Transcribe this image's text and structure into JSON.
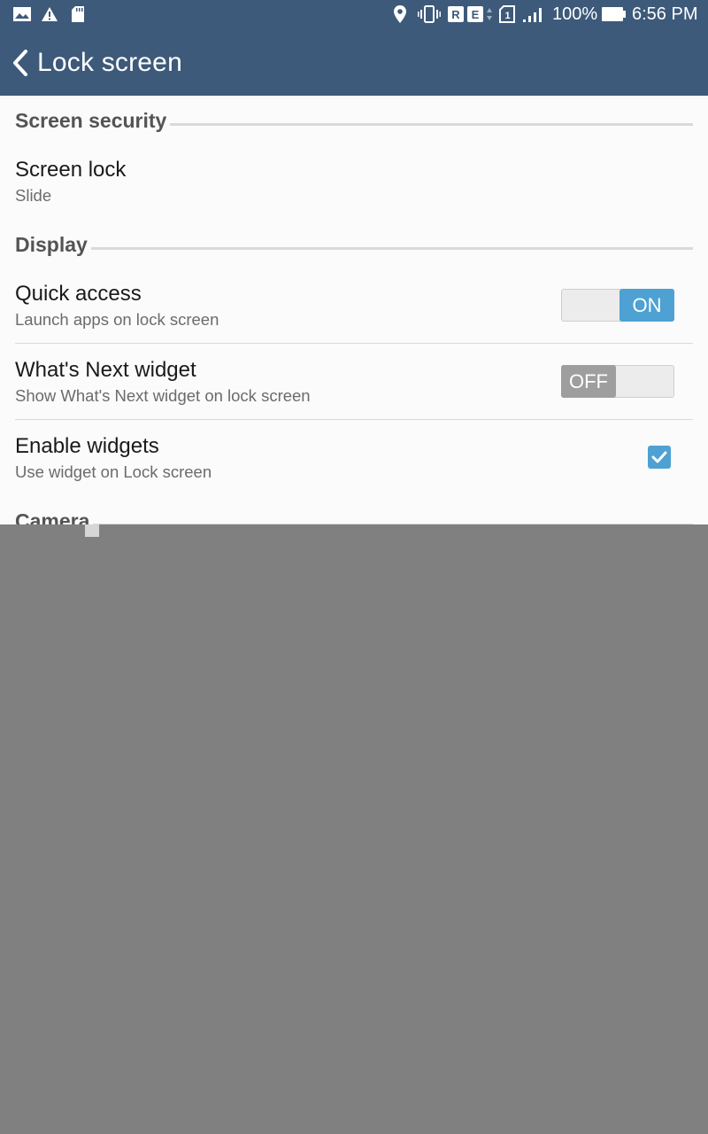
{
  "status_bar": {
    "icons_left": [
      "image-icon",
      "warning-icon",
      "sd-card-icon"
    ],
    "icons_right": [
      "location-icon",
      "vibrate-icon",
      "sim-r-icon",
      "sim-e-icon",
      "data-arrows-icon",
      "sim-1-icon",
      "signal-icon"
    ],
    "battery": "100%",
    "time": "6:56 PM"
  },
  "action_bar": {
    "title": "Lock screen",
    "back_icon": "chevron-left-icon"
  },
  "sections": {
    "security": {
      "header": "Screen security"
    },
    "display": {
      "header": "Display"
    },
    "camera": {
      "header": "Camera"
    }
  },
  "settings": {
    "screen_lock": {
      "title": "Screen lock",
      "summary": "Slide"
    },
    "quick_access": {
      "title": "Quick access",
      "summary": "Launch apps on lock screen",
      "toggle_label": "ON"
    },
    "whats_next": {
      "title": "What's Next widget",
      "summary": "Show What's Next widget on lock screen",
      "toggle_label": "OFF"
    },
    "enable_widgets": {
      "title": "Enable widgets",
      "summary": "Use widget on Lock screen",
      "checked": true
    }
  },
  "colors": {
    "bar": "#3d5a7a",
    "accent": "#4ea1d3",
    "toggle_off": "#9e9e9e"
  }
}
